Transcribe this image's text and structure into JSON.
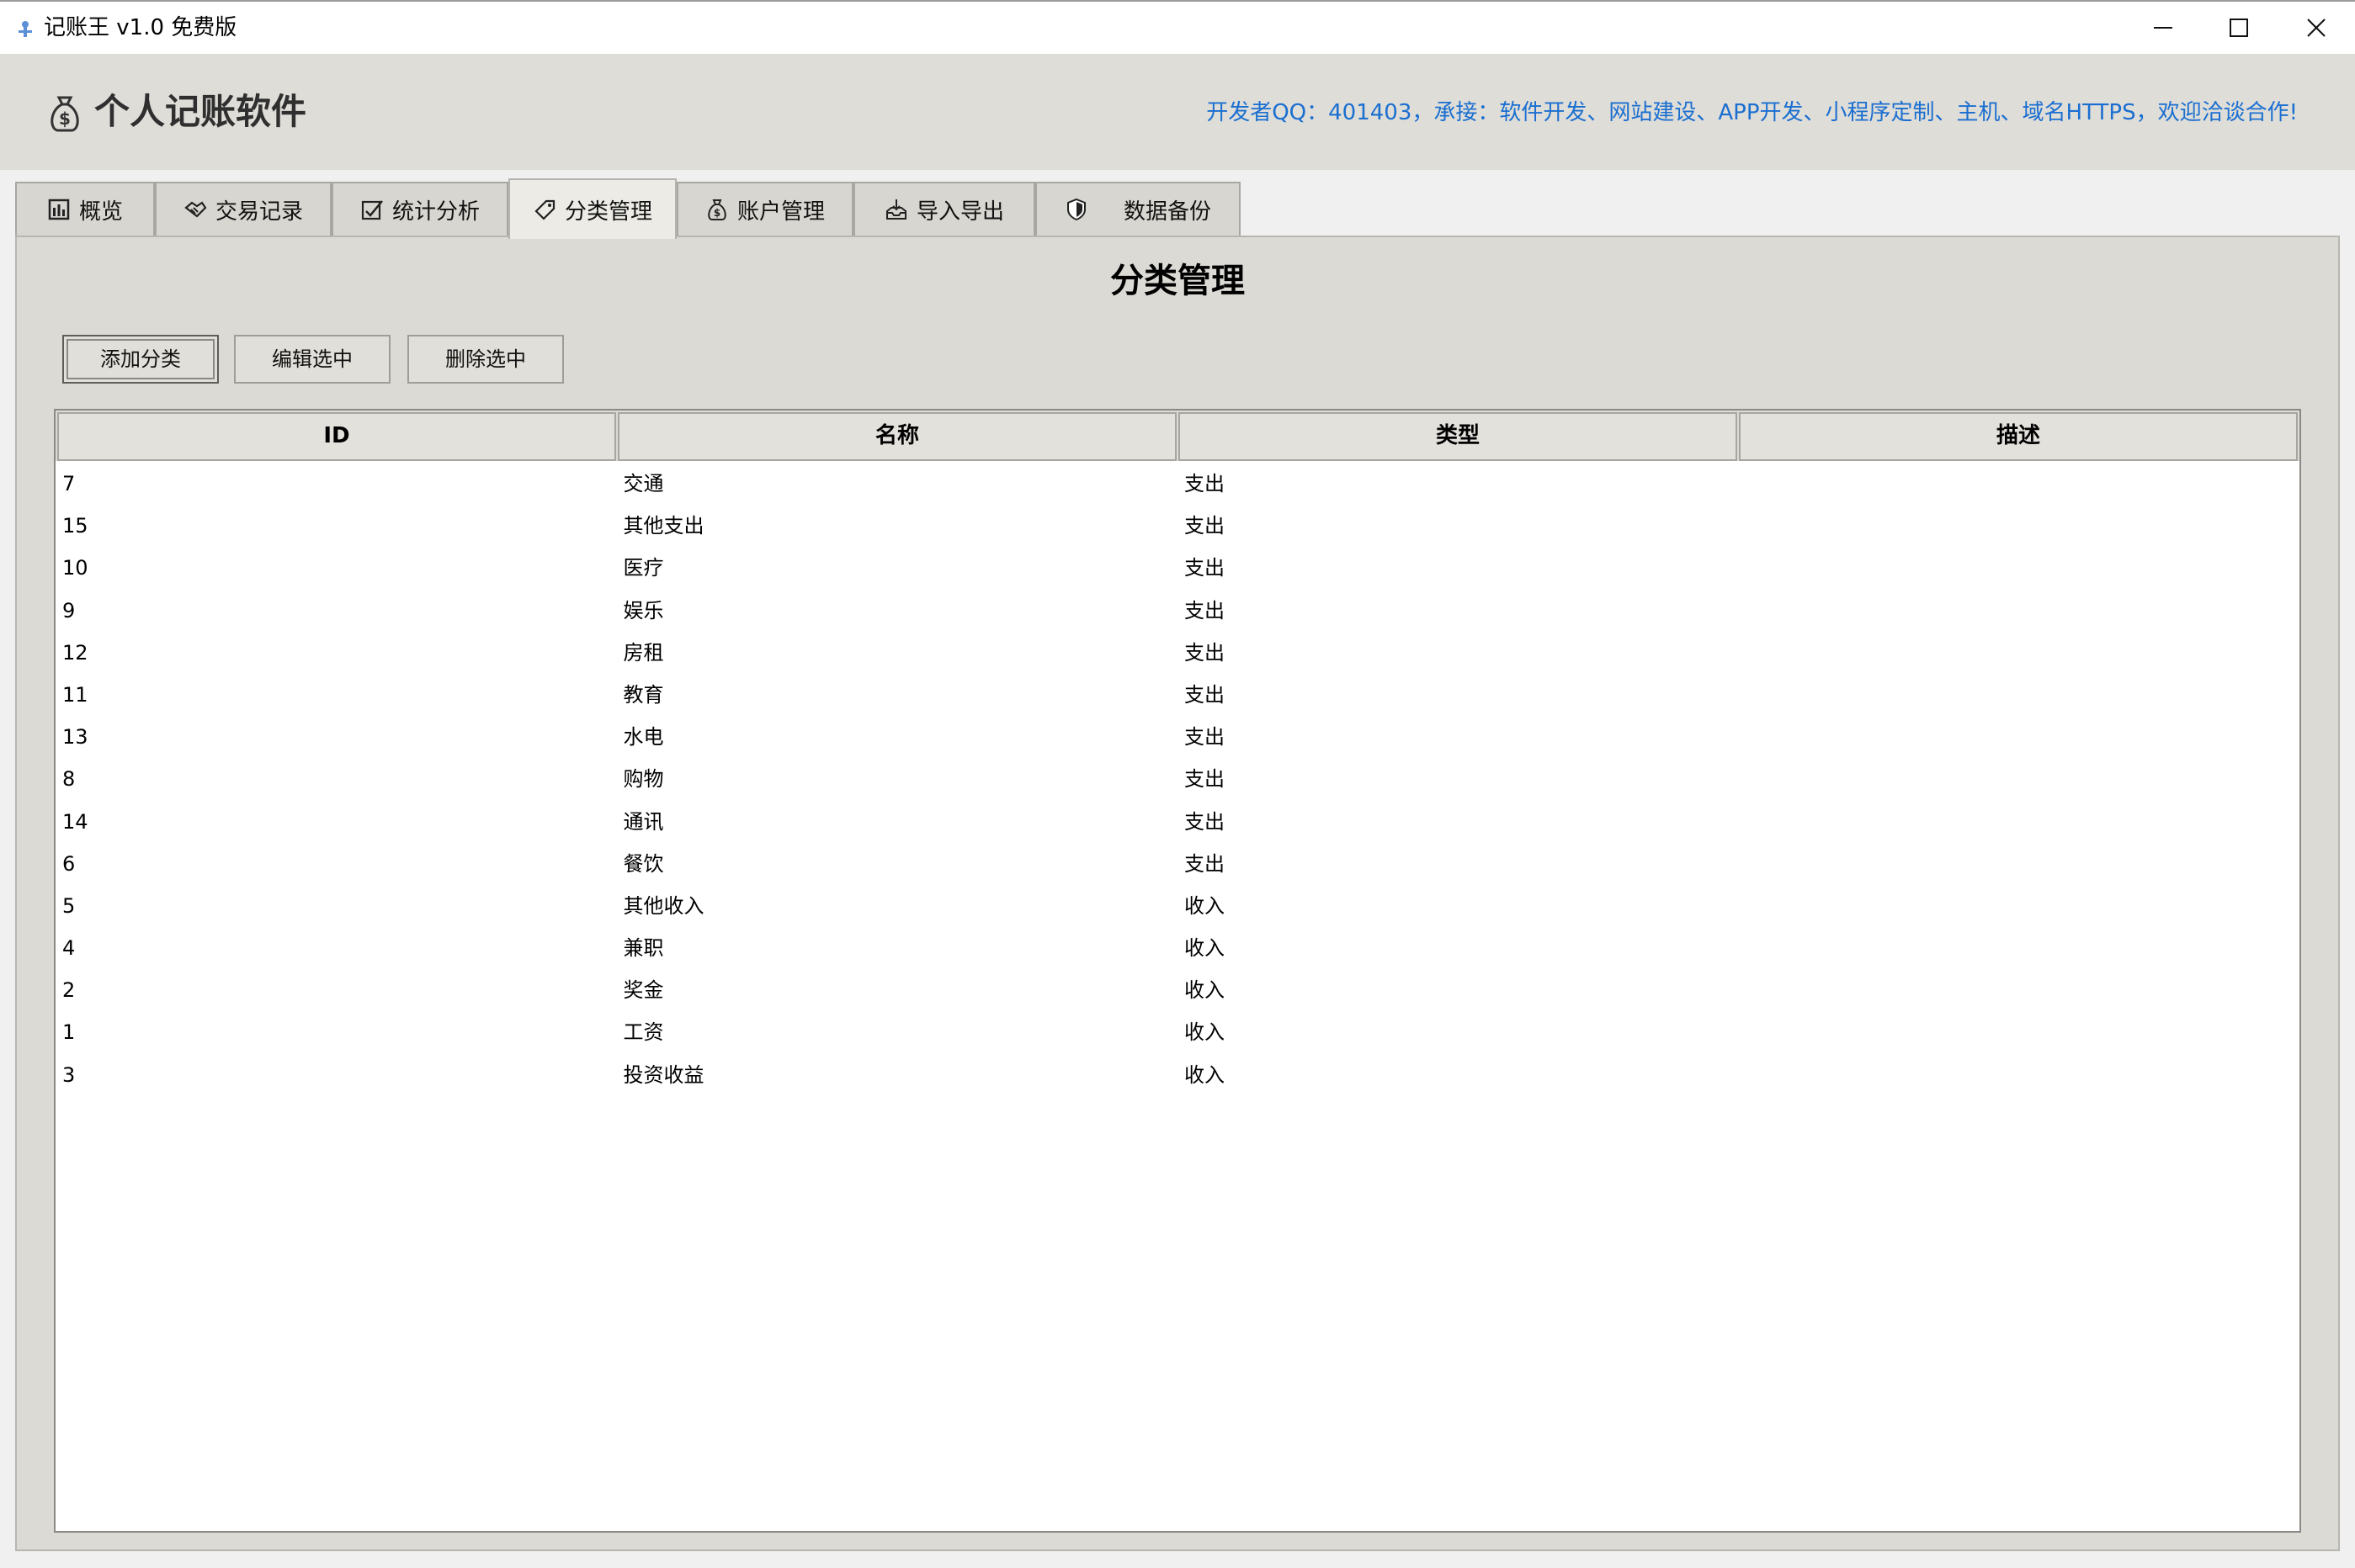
{
  "window": {
    "title": "记账王 v1.0 免费版",
    "icon": "app-icon",
    "controls": {
      "minimize": "minimize-icon",
      "maximize": "maximize-icon",
      "close": "close-icon"
    }
  },
  "header": {
    "app_title": "个人记账软件",
    "logo_icon": "money-bag-icon",
    "contact": "开发者QQ：401403，承接：软件开发、网站建设、APP开发、小程序定制、主机、域名HTTPS，欢迎洽谈合作!",
    "contact_color": "#1a6fd0"
  },
  "tabs": [
    {
      "label": "概览",
      "icon": "bar-chart-icon"
    },
    {
      "label": "交易记录",
      "icon": "handshake-icon"
    },
    {
      "label": "统计分析",
      "icon": "checkbox-chart-icon"
    },
    {
      "label": "分类管理",
      "icon": "tag-icon",
      "active": true
    },
    {
      "label": "账户管理",
      "icon": "money-bag-icon"
    },
    {
      "label": "导入导出",
      "icon": "inbox-tray-icon"
    },
    {
      "label": "数据备份",
      "icon": "shield-icon"
    }
  ],
  "panel": {
    "title": "分类管理",
    "buttons": {
      "add": "添加分类",
      "edit": "编辑选中",
      "delete": "删除选中"
    }
  },
  "table": {
    "columns": [
      "ID",
      "名称",
      "类型",
      "描述"
    ],
    "rows": [
      [
        "7",
        "交通",
        "支出",
        ""
      ],
      [
        "15",
        "其他支出",
        "支出",
        ""
      ],
      [
        "10",
        "医疗",
        "支出",
        ""
      ],
      [
        "9",
        "娱乐",
        "支出",
        ""
      ],
      [
        "12",
        "房租",
        "支出",
        ""
      ],
      [
        "11",
        "教育",
        "支出",
        ""
      ],
      [
        "13",
        "水电",
        "支出",
        ""
      ],
      [
        "8",
        "购物",
        "支出",
        ""
      ],
      [
        "14",
        "通讯",
        "支出",
        ""
      ],
      [
        "6",
        "餐饮",
        "支出",
        ""
      ],
      [
        "5",
        "其他收入",
        "收入",
        ""
      ],
      [
        "4",
        "兼职",
        "收入",
        ""
      ],
      [
        "2",
        "奖金",
        "收入",
        ""
      ],
      [
        "1",
        "工资",
        "收入",
        ""
      ],
      [
        "3",
        "投资收益",
        "收入",
        ""
      ]
    ]
  }
}
